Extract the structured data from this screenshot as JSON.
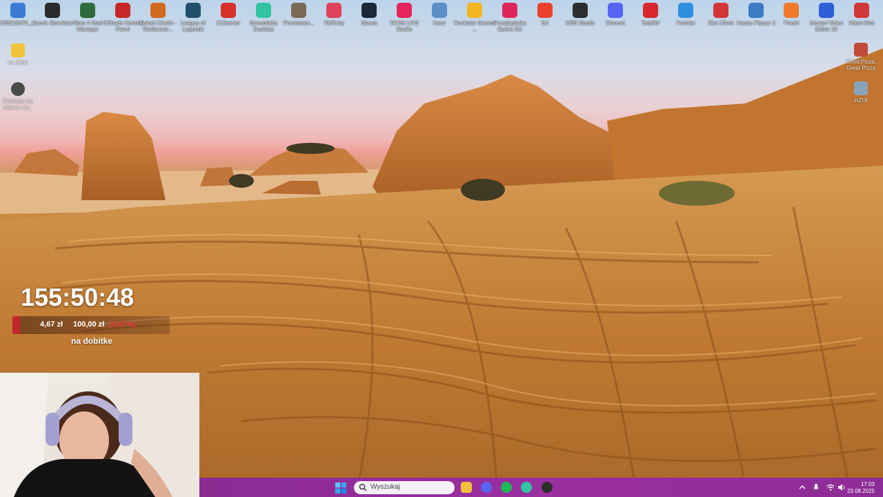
{
  "desktop": {
    "top_icons": [
      {
        "label": "500218475_...",
        "icon": "document-icon",
        "color": "#3b7bd4"
      },
      {
        "label": "Ranch Simulator",
        "icon": "ranch-simulator-icon",
        "color": "#2b2b2b"
      },
      {
        "label": "Sims 4 Mod Manager",
        "icon": "sims-icon",
        "color": "#2f6b3a"
      },
      {
        "label": "GShade Control Panel",
        "icon": "gshade-icon",
        "color": "#c62828"
      },
      {
        "label": "Kebab Chefs! - Restauran...",
        "icon": "kebab-chefs-icon",
        "color": "#d2691e"
      },
      {
        "label": "League of Legends",
        "icon": "league-of-legends-icon",
        "color": "#1f4f6b"
      },
      {
        "label": "CCleaner",
        "icon": "ccleaner-icon",
        "color": "#d8302b"
      },
      {
        "label": "Streamlabs Desktop",
        "icon": "streamlabs-icon",
        "color": "#31c3a2"
      },
      {
        "label": "Porofessor...",
        "icon": "porofessor-icon",
        "color": "#7a6a55"
      },
      {
        "label": "TikFinity",
        "icon": "tikfinity-icon",
        "color": "#e0415b"
      },
      {
        "label": "Steam",
        "icon": "steam-icon",
        "color": "#1b2838"
      },
      {
        "label": "TikTok LIVE Studio",
        "icon": "tiktok-icon",
        "color": "#e4245b"
      },
      {
        "label": "Kosz",
        "icon": "recycle-bin-icon",
        "color": "#5a8fc7"
      },
      {
        "label": "Rockstar Games ...",
        "icon": "rockstar-icon",
        "color": "#f2b51f"
      },
      {
        "label": "Przeglądarka Opera GX",
        "icon": "opera-gx-icon",
        "color": "#e0245b"
      },
      {
        "label": "EA",
        "icon": "ea-icon",
        "color": "#e8422e"
      },
      {
        "label": "OBS Studio",
        "icon": "obs-icon",
        "color": "#2d2d2d"
      },
      {
        "label": "Discord",
        "icon": "discord-icon",
        "color": "#5865f2"
      },
      {
        "label": "TotalAV",
        "icon": "totalav-icon",
        "color": "#d8262e"
      },
      {
        "label": "Fortnite",
        "icon": "fortnite-icon",
        "color": "#2f8fdc"
      },
      {
        "label": "Riot Client",
        "icon": "riot-client-icon",
        "color": "#d13639"
      },
      {
        "label": "House Flipper 2",
        "icon": "house-flipper-icon",
        "color": "#3a7bc4"
      },
      {
        "label": "FiveM",
        "icon": "fivem-icon",
        "color": "#f07a2a"
      },
      {
        "label": "Movavi Video Editor 24",
        "icon": "movavi-icon",
        "color": "#2c5fd6"
      },
      {
        "label": "Klient Riot",
        "icon": "riot-client-icon",
        "color": "#d13639"
      }
    ],
    "left_icons": [
      {
        "label": "ss skins",
        "icon": "folder-icon",
        "color": "#f0c43a"
      },
      {
        "label": "Dowiedz się więcej o ty...",
        "icon": "learn-more-icon",
        "color": "#4a4a4a"
      }
    ],
    "right_icons": [
      {
        "label": "Good Pizza, Great Pizza",
        "icon": "good-pizza-icon",
        "color": "#c24a3a"
      },
      {
        "label": "inZOI",
        "icon": "inzoi-icon",
        "color": "#8aa3bd"
      }
    ]
  },
  "overlay": {
    "timer": "155:50:48",
    "goal_current": "4,67 zł",
    "goal_target": "100,00 zł",
    "goal_percent": "(4,67%)",
    "goal_fraction": 0.0467,
    "caption": "na dobitke"
  },
  "taskbar": {
    "search_placeholder": "Wyszukaj",
    "pinned": [
      {
        "icon": "file-explorer-icon",
        "color": "#f2c13a"
      },
      {
        "icon": "discord-icon",
        "color": "#5865f2"
      },
      {
        "icon": "spotify-icon",
        "color": "#1db954"
      },
      {
        "icon": "streamlabs-icon",
        "color": "#31c3a2"
      },
      {
        "icon": "obs-icon",
        "color": "#2d2d2d"
      }
    ],
    "time": "17:03",
    "date": "23.08.2025"
  },
  "colors": {
    "taskbar": "#9a2f9f",
    "accent": "#c3262b"
  }
}
